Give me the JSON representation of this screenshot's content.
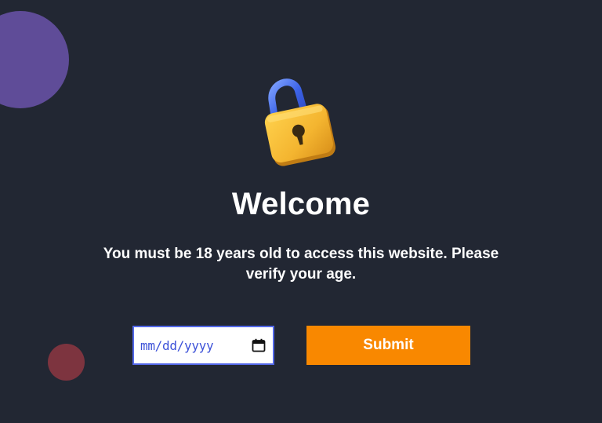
{
  "decor": {
    "purple_circle_color": "#5f4c98",
    "red_circle_color": "#7d343f"
  },
  "hero": {
    "icon": "open-padlock-icon",
    "title": "Welcome",
    "message": "You must be 18 years old to access this website. Please verify your age."
  },
  "form": {
    "date_placeholder": "mm/dd/yyyy",
    "calendar_icon": "calendar-icon",
    "submit_label": "Submit"
  },
  "colors": {
    "background": "#222733",
    "accent": "#f98800",
    "input_border": "#5267e8"
  }
}
